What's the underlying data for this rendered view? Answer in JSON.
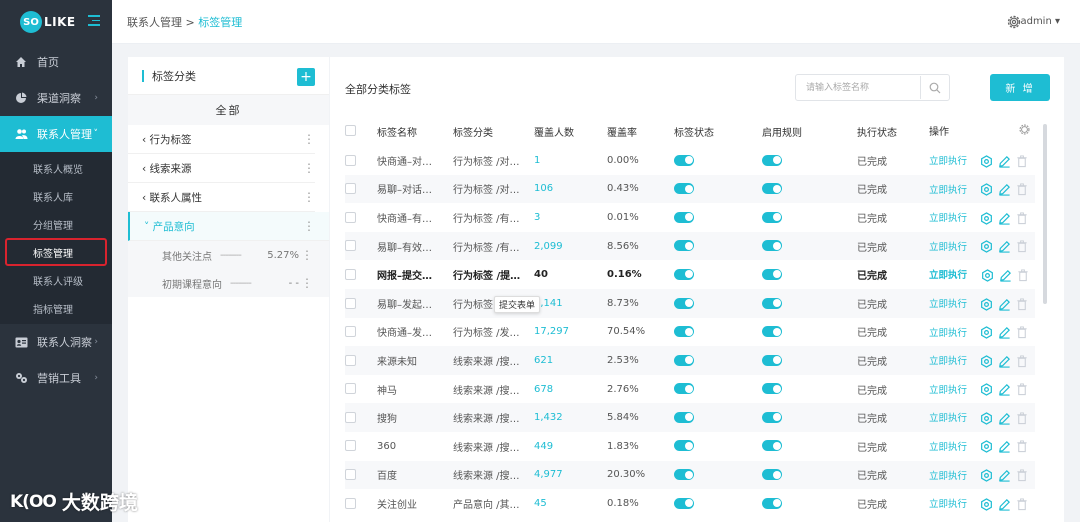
{
  "brand": {
    "so": "SO",
    "like": "LIKE"
  },
  "header": {
    "crumb_parent": "联系人管理 >",
    "crumb_current": "标签管理",
    "user": "admin ▾"
  },
  "sidebar": {
    "items": [
      {
        "label": "首页",
        "icon": "home-icon"
      },
      {
        "label": "渠道洞察",
        "icon": "pie-chart-icon",
        "arrow": "›"
      },
      {
        "label": "联系人管理",
        "icon": "users-icon",
        "arrow": "˅"
      },
      {
        "label": "联系人洞察",
        "icon": "id-card-icon",
        "arrow": "›"
      },
      {
        "label": "营销工具",
        "icon": "tools-icon",
        "arrow": "›"
      }
    ],
    "subitems": [
      "联系人概览",
      "联系人库",
      "分组管理",
      "标签管理",
      "联系人评级",
      "指标管理"
    ]
  },
  "categories": {
    "title": "标签分类",
    "add": "+",
    "all": "全部",
    "rows": [
      {
        "label": "‹ 行为标签"
      },
      {
        "label": "‹ 线索来源"
      },
      {
        "label": "‹ 联系人属性"
      },
      {
        "label": "˅ 产品意向"
      }
    ],
    "children": [
      {
        "label": "其他关注点",
        "dash": "--------",
        "pct": "5.27%"
      },
      {
        "label": "初期课程意向",
        "dash": "--------",
        "pct": "- -"
      }
    ],
    "more": "⋮"
  },
  "main": {
    "title": "全部分类标签",
    "search_placeholder": "请输入标签名称",
    "new_button": "新 增",
    "tooltip": "提交表单",
    "columns": [
      "标签名称",
      "标签分类",
      "覆盖人数",
      "覆盖率",
      "标签状态",
      "启用规则",
      "执行状态",
      "操作"
    ],
    "run_label": "立即执行",
    "rows": [
      {
        "name": "快商通–对…",
        "category": "行为标签 /对…",
        "count": "1",
        "rate": "0.00%",
        "status": "已完成"
      },
      {
        "name": "易聊–对话…",
        "category": "行为标签 /对…",
        "count": "106",
        "rate": "0.43%",
        "status": "已完成"
      },
      {
        "name": "快商通–有…",
        "category": "行为标签 /有…",
        "count": "3",
        "rate": "0.01%",
        "status": "已完成"
      },
      {
        "name": "易聊–有效…",
        "category": "行为标签 /有…",
        "count": "2,099",
        "rate": "8.56%",
        "status": "已完成"
      },
      {
        "name": "网报–提交…",
        "category": "行为标签 /提…",
        "count": "40",
        "rate": "0.16%",
        "status": "已完成"
      },
      {
        "name": "易聊–发起…",
        "category": "行为标签",
        "count": "2,141",
        "rate": "8.73%",
        "status": "已完成"
      },
      {
        "name": "快商通–发…",
        "category": "行为标签 /发…",
        "count": "17,297",
        "rate": "70.54%",
        "status": "已完成"
      },
      {
        "name": "来源未知",
        "category": "线索来源 /搜…",
        "count": "621",
        "rate": "2.53%",
        "status": "已完成"
      },
      {
        "name": "神马",
        "category": "线索来源 /搜…",
        "count": "678",
        "rate": "2.76%",
        "status": "已完成"
      },
      {
        "name": "搜狗",
        "category": "线索来源 /搜…",
        "count": "1,432",
        "rate": "5.84%",
        "status": "已完成"
      },
      {
        "name": "360",
        "category": "线索来源 /搜…",
        "count": "449",
        "rate": "1.83%",
        "status": "已完成"
      },
      {
        "name": "百度",
        "category": "线索来源 /搜…",
        "count": "4,977",
        "rate": "20.30%",
        "status": "已完成"
      },
      {
        "name": "关注创业",
        "category": "产品意向 /其…",
        "count": "45",
        "rate": "0.18%",
        "status": "已完成"
      }
    ]
  },
  "watermark": {
    "logo": "K(OO",
    "text": "大数跨境"
  },
  "colors": {
    "accent": "#1ebdd3",
    "sidebar": "#2b333d",
    "highlight": "#d9232e"
  }
}
